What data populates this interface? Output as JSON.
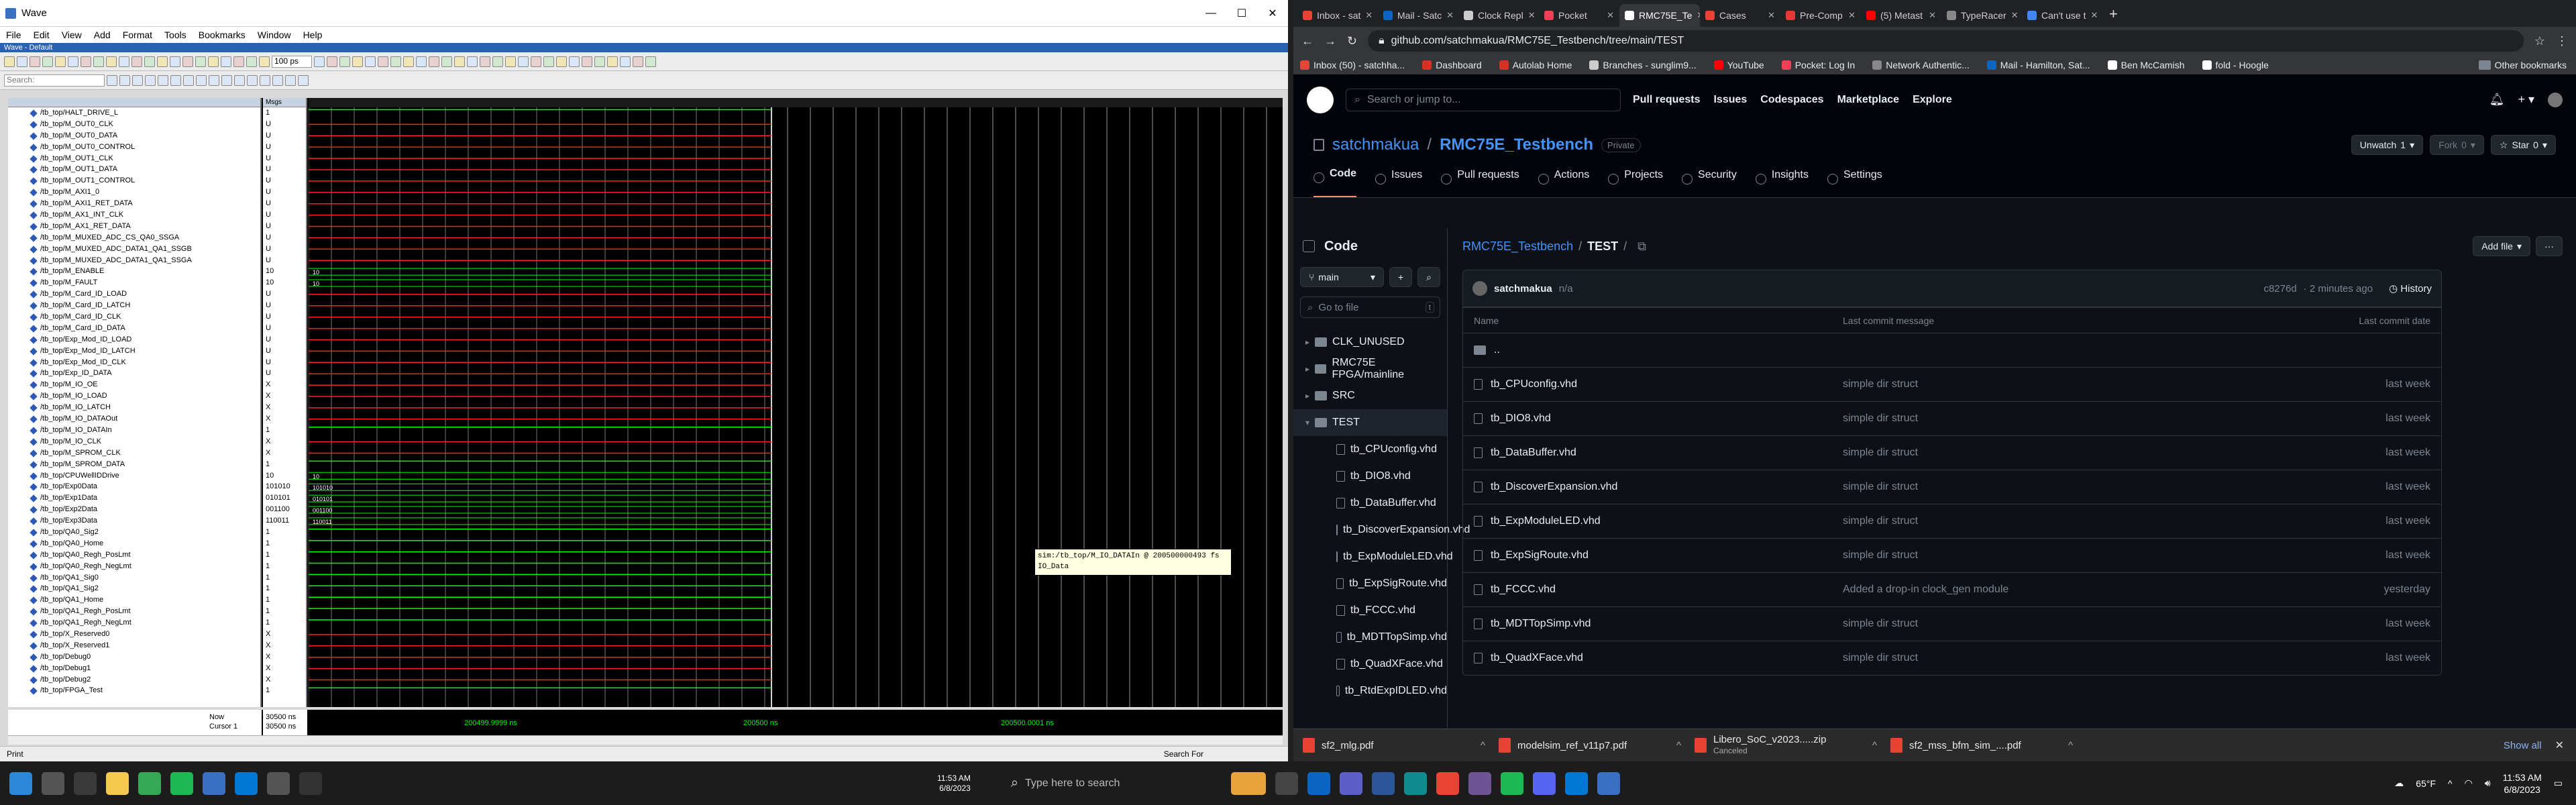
{
  "wave": {
    "title": "Wave",
    "subtitle": "Wave - Default",
    "menu": [
      "File",
      "Edit",
      "View",
      "Add",
      "Format",
      "Tools",
      "Bookmarks",
      "Window",
      "Help"
    ],
    "find_placeholder": "Search:",
    "time_value": "100 ps",
    "col_header_msgs": "Msgs",
    "signals": [
      {
        "n": "/tb_top/HALT_DRIVE_L",
        "v": "1"
      },
      {
        "n": "/tb_top/M_OUT0_CLK",
        "v": "U"
      },
      {
        "n": "/tb_top/M_OUT0_DATA",
        "v": "U"
      },
      {
        "n": "/tb_top/M_OUT0_CONTROL",
        "v": "U"
      },
      {
        "n": "/tb_top/M_OUT1_CLK",
        "v": "U"
      },
      {
        "n": "/tb_top/M_OUT1_DATA",
        "v": "U"
      },
      {
        "n": "/tb_top/M_OUT1_CONTROL",
        "v": "U"
      },
      {
        "n": "/tb_top/M_AXI1_0",
        "v": "U"
      },
      {
        "n": "/tb_top/M_AXI1_RET_DATA",
        "v": "U"
      },
      {
        "n": "/tb_top/M_AX1_INT_CLK",
        "v": "U"
      },
      {
        "n": "/tb_top/M_AX1_RET_DATA",
        "v": "U"
      },
      {
        "n": "/tb_top/M_MUXED_ADC_CS_QA0_SSGA",
        "v": "U"
      },
      {
        "n": "/tb_top/M_MUXED_ADC_DATA1_QA1_SSGB",
        "v": "U"
      },
      {
        "n": "/tb_top/M_MUXED_ADC_DATA1_QA1_SSGA",
        "v": "U"
      },
      {
        "n": "/tb_top/M_ENABLE",
        "v": "10"
      },
      {
        "n": "/tb_top/M_FAULT",
        "v": "10"
      },
      {
        "n": "/tb_top/M_Card_ID_LOAD",
        "v": "U"
      },
      {
        "n": "/tb_top/M_Card_ID_LATCH",
        "v": "U"
      },
      {
        "n": "/tb_top/M_Card_ID_CLK",
        "v": "U"
      },
      {
        "n": "/tb_top/M_Card_ID_DATA",
        "v": "U"
      },
      {
        "n": "/tb_top/Exp_Mod_ID_LOAD",
        "v": "U"
      },
      {
        "n": "/tb_top/Exp_Mod_ID_LATCH",
        "v": "U"
      },
      {
        "n": "/tb_top/Exp_Mod_ID_CLK",
        "v": "U"
      },
      {
        "n": "/tb_top/Exp_ID_DATA",
        "v": "U"
      },
      {
        "n": "/tb_top/M_IO_OE",
        "v": "X"
      },
      {
        "n": "/tb_top/M_IO_LOAD",
        "v": "X"
      },
      {
        "n": "/tb_top/M_IO_LATCH",
        "v": "X"
      },
      {
        "n": "/tb_top/M_IO_DATAOut",
        "v": "X"
      },
      {
        "n": "/tb_top/M_IO_DATAIn",
        "v": "1"
      },
      {
        "n": "/tb_top/M_IO_CLK",
        "v": "X"
      },
      {
        "n": "/tb_top/M_SPROM_CLK",
        "v": "X"
      },
      {
        "n": "/tb_top/M_SPROM_DATA",
        "v": "1"
      },
      {
        "n": "/tb_top/CPUWellIDDrive",
        "v": "10"
      },
      {
        "n": "/tb_top/Exp0Data",
        "v": "101010"
      },
      {
        "n": "/tb_top/Exp1Data",
        "v": "010101"
      },
      {
        "n": "/tb_top/Exp2Data",
        "v": "001100"
      },
      {
        "n": "/tb_top/Exp3Data",
        "v": "110011"
      },
      {
        "n": "/tb_top/QA0_Sig2",
        "v": "1"
      },
      {
        "n": "/tb_top/QA0_Home",
        "v": "1"
      },
      {
        "n": "/tb_top/QA0_Regh_PosLmt",
        "v": "1"
      },
      {
        "n": "/tb_top/QA0_Regh_NegLmt",
        "v": "1"
      },
      {
        "n": "/tb_top/QA1_Sig0",
        "v": "1"
      },
      {
        "n": "/tb_top/QA1_Sig2",
        "v": "1"
      },
      {
        "n": "/tb_top/QA1_Home",
        "v": "1"
      },
      {
        "n": "/tb_top/QA1_Regh_PosLmt",
        "v": "1"
      },
      {
        "n": "/tb_top/QA1_Regh_NegLmt",
        "v": "1"
      },
      {
        "n": "/tb_top/X_Reserved0",
        "v": "X"
      },
      {
        "n": "/tb_top/X_Reserved1",
        "v": "X"
      },
      {
        "n": "/tb_top/Debug0",
        "v": "X"
      },
      {
        "n": "/tb_top/Debug1",
        "v": "X"
      },
      {
        "n": "/tb_top/Debug2",
        "v": "X"
      },
      {
        "n": "/tb_top/FPGA_Test",
        "v": "1"
      }
    ],
    "now_label": "Now",
    "now_value": "30500 ns",
    "cursor_label": "Cursor 1",
    "cursor_value": "30500 ns",
    "time_ticks": [
      "200499.9999 ns",
      "200500 ns",
      "200500.0001 ns"
    ],
    "tooltip_line1": "sim:/tb_top/M_IO_DATAIn @ 200500000493 fs",
    "tooltip_line2": "IO_Data",
    "bottom_label": "Print",
    "search_label": "Search For"
  },
  "browser": {
    "tabs": [
      {
        "label": "Inbox - sat",
        "color": "#ea4335"
      },
      {
        "label": "Mail - Satc",
        "color": "#0a66c2"
      },
      {
        "label": "Clock Repl",
        "color": "#cccccc"
      },
      {
        "label": "Pocket",
        "color": "#ef4056"
      },
      {
        "label": "RMC75E_Te",
        "color": "#ffffff"
      },
      {
        "label": "Cases",
        "color": "#ea4335"
      },
      {
        "label": "Pre-Comp",
        "color": "#e53935"
      },
      {
        "label": "(5) Metast",
        "color": "#ff0000"
      },
      {
        "label": "TypeRacer",
        "color": "#888888"
      },
      {
        "label": "Can't use t",
        "color": "#4285f4"
      }
    ],
    "active_tab": 4,
    "url": "github.com/satchmakua/RMC75E_Testbench/tree/main/TEST",
    "bookmarks": [
      {
        "label": "Inbox (50) - satchha...",
        "color": "#ea4335"
      },
      {
        "label": "Dashboard",
        "color": "#d93025"
      },
      {
        "label": "Autolab Home",
        "color": "#d93025"
      },
      {
        "label": "Branches - sunglim9...",
        "color": "#cccccc"
      },
      {
        "label": "YouTube",
        "color": "#ff0000"
      },
      {
        "label": "Pocket: Log In",
        "color": "#ef4056"
      },
      {
        "label": "Network Authentic...",
        "color": "#888888"
      },
      {
        "label": "Mail - Hamilton, Sat...",
        "color": "#0a66c2"
      },
      {
        "label": "Ben McCamish",
        "color": "#ffffff"
      },
      {
        "label": "fold - Hoogle",
        "color": "#ffffff"
      }
    ],
    "other_bookmarks": "Other bookmarks"
  },
  "github": {
    "search_placeholder": "Search or jump to...",
    "nav": [
      "Pull requests",
      "Issues",
      "Codespaces",
      "Marketplace",
      "Explore"
    ],
    "owner": "satchmakua",
    "repo": "RMC75E_Testbench",
    "visibility": "Private",
    "unwatch_label": "Unwatch",
    "unwatch_count": "1",
    "fork_label": "Fork",
    "fork_count": "0",
    "star_label": "Star",
    "star_count": "0",
    "tabs": [
      "Code",
      "Issues",
      "Pull requests",
      "Actions",
      "Projects",
      "Security",
      "Insights",
      "Settings"
    ],
    "code_heading": "Code",
    "branch": "main",
    "goto_placeholder": "Go to file",
    "goto_key": "t",
    "tree": [
      {
        "label": "CLK_UNUSED",
        "type": "dir",
        "depth": 0
      },
      {
        "label": "RMC75E FPGA/mainline",
        "type": "dir",
        "depth": 0
      },
      {
        "label": "SRC",
        "type": "dir",
        "depth": 0
      },
      {
        "label": "TEST",
        "type": "dir",
        "depth": 0
      },
      {
        "label": "tb_CPUconfig.vhd",
        "type": "file",
        "depth": 1
      },
      {
        "label": "tb_DIO8.vhd",
        "type": "file",
        "depth": 1
      },
      {
        "label": "tb_DataBuffer.vhd",
        "type": "file",
        "depth": 1
      },
      {
        "label": "tb_DiscoverExpansion.vhd",
        "type": "file",
        "depth": 1
      },
      {
        "label": "tb_ExpModuleLED.vhd",
        "type": "file",
        "depth": 1
      },
      {
        "label": "tb_ExpSigRoute.vhd",
        "type": "file",
        "depth": 1
      },
      {
        "label": "tb_FCCC.vhd",
        "type": "file",
        "depth": 1
      },
      {
        "label": "tb_MDTTopSimp.vhd",
        "type": "file",
        "depth": 1
      },
      {
        "label": "tb_QuadXFace.vhd",
        "type": "file",
        "depth": 1
      },
      {
        "label": "tb_RtdExpIDLED.vhd",
        "type": "file",
        "depth": 1
      }
    ],
    "breadcrumb_repo": "RMC75E_Testbench",
    "breadcrumb_dir": "TEST",
    "add_file": "Add file",
    "commit_author": "satchmakua",
    "commit_msg": "n/a",
    "commit_hash": "c8276d",
    "commit_time": "· 2 minutes ago",
    "history": "History",
    "col_name": "Name",
    "col_msg": "Last commit message",
    "col_date": "Last commit date",
    "parent": "..",
    "files": [
      {
        "name": "tb_CPUconfig.vhd",
        "msg": "simple dir struct",
        "date": "last week"
      },
      {
        "name": "tb_DIO8.vhd",
        "msg": "simple dir struct",
        "date": "last week"
      },
      {
        "name": "tb_DataBuffer.vhd",
        "msg": "simple dir struct",
        "date": "last week"
      },
      {
        "name": "tb_DiscoverExpansion.vhd",
        "msg": "simple dir struct",
        "date": "last week"
      },
      {
        "name": "tb_ExpModuleLED.vhd",
        "msg": "simple dir struct",
        "date": "last week"
      },
      {
        "name": "tb_ExpSigRoute.vhd",
        "msg": "simple dir struct",
        "date": "last week"
      },
      {
        "name": "tb_FCCC.vhd",
        "msg": "Added a drop-in clock_gen module",
        "date": "yesterday"
      },
      {
        "name": "tb_MDTTopSimp.vhd",
        "msg": "simple dir struct",
        "date": "last week"
      },
      {
        "name": "tb_QuadXFace.vhd",
        "msg": "simple dir struct",
        "date": "last week"
      }
    ]
  },
  "downloads": [
    {
      "name": "sf2_mlg.pdf",
      "sub": ""
    },
    {
      "name": "modelsim_ref_v11p7.pdf",
      "sub": ""
    },
    {
      "name": "Libero_SoC_v2023.....zip",
      "sub": "Canceled"
    },
    {
      "name": "sf2_mss_bfm_sim_....pdf",
      "sub": ""
    }
  ],
  "show_all": "Show all",
  "taskbar": {
    "search_placeholder": "Type here to search",
    "left_time": "11:53 AM",
    "left_date": "6/8/2023",
    "weather": "65°F",
    "time": "11:53 AM",
    "date": "6/8/2023"
  }
}
